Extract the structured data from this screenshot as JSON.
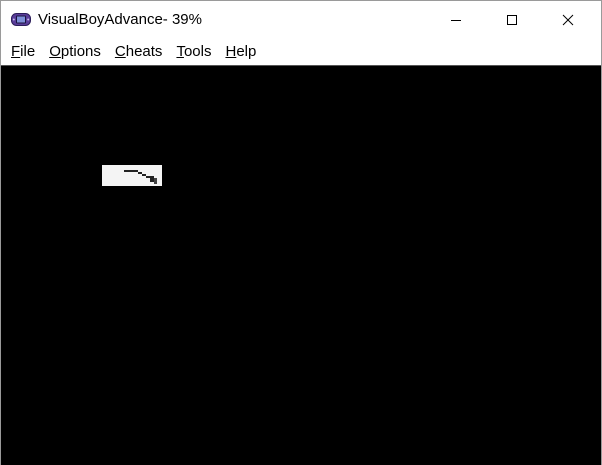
{
  "window": {
    "title": "VisualBoyAdvance- 39%",
    "icon": "gba-console-icon",
    "controls": [
      "minimize-icon",
      "maximize-icon",
      "close-icon"
    ]
  },
  "menu": {
    "items": [
      {
        "label": "File",
        "accel": "F",
        "rest": "ile"
      },
      {
        "label": "Options",
        "accel": "O",
        "rest": "ptions"
      },
      {
        "label": "Cheats",
        "accel": "C",
        "rest": "heats"
      },
      {
        "label": "Tools",
        "accel": "T",
        "rest": "ools"
      },
      {
        "label": "Help",
        "accel": "H",
        "rest": "elp"
      }
    ]
  },
  "display": {
    "background": "#000000",
    "sprite_color": "#f4f4f4"
  }
}
